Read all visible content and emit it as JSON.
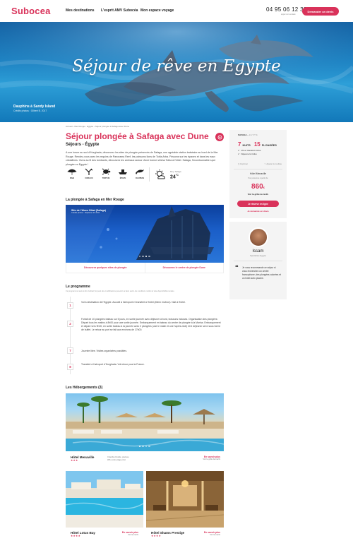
{
  "header": {
    "logo": "Subocea",
    "nav": [
      "Mes destinations",
      "L'esprit AMV Subocéa",
      "Mon espace voyage"
    ],
    "phone": "04 95 06 12 39",
    "phone_sub": "appel non surtaxé",
    "cta": "Demander un devis"
  },
  "hero": {
    "title": "Séjour de rêve en Egypte",
    "caption_title": "Dauphins à Sandy Island",
    "caption_credit": "Crédits photos : Gilbert B. 2017"
  },
  "breadcrumb": "Accueil › Mer Rouge › Egypte › Séjour plongée à Safaga avec Dune",
  "trip": {
    "title": "Séjour plongée à Safaga avec Dune",
    "subtitle": "Séjours - Égypte",
    "intro": "A une heure au sud d'Hurghada, découvrez les sites de plongée préservés de Safaga, une agréable station balnéaire au bord de la Mer Rouge. Rendez-vous avec les requins de Panorama Reef, les poissons lions de Tobia Arba. Frissons sur les épaves et dans les eaux cristallines. Vivez au fil des tombants, découvrez les animaux autour d'une bonne shisha Tobia à l'hôtel. Safaga, l'incontournable spot plongée en Egypte !",
    "fauna": [
      {
        "icon": "ray-icon",
        "label": "RAIE"
      },
      {
        "icon": "coral-icon",
        "label": "CORAUX"
      },
      {
        "icon": "turtle-icon",
        "label": "TORTUE"
      },
      {
        "icon": "wreck-icon",
        "label": "ÉPAVE"
      },
      {
        "icon": "dolphin-icon",
        "label": "DAUPHIN"
      }
    ],
    "weather_label": "Moy. Safaga",
    "weather_temp": "24",
    "weather_unit": "°C"
  },
  "dive": {
    "section_title": "La plongée à Safaga en Mer Rouge",
    "caption_title": "Site de l'Abou Gibal (Safaga)",
    "caption_credit": "Crédits photos : Stéphane M. 2016",
    "link_left": "Découvrez quelques sites de plongée",
    "link_right": "Découvrez le centre de plongée Dune"
  },
  "program": {
    "title": "Le programme",
    "note": "Ce programme reste à titre indicatif, le pack des modifications peuvent se faire selon les conditions météo et des disponibilités locales.",
    "days": [
      {
        "day": "1",
        "text": "Vol à destination de l'Egypte. Accueil à l'aéroport et transfert à l'hôtel (45mn environ). Nuit à l'hôtel."
      },
      {
        "day": "2",
        "text": "Forfait de 10 plongées bateau sur 5 jours, en sortie journée avec déjeuner à bord, boissons incluses. Organisation des plongées : Départ tous les matins à 8h00 pour une sortie journée. Embarquement en bateau du centre de plongée à la Marina. Embarquement et départ vers 9h00, en sortie bateau à la journée avec 2 plongées (une le matin et une l'après-midi) et le déjeuner servi sous forme de buffet. Le retour au port se fait aux environs de 17h00."
      },
      {
        "day": "7",
        "text": "Journée libre. Visites organisées possibles."
      },
      {
        "day": "8",
        "text": "Transfert à l'aéroport d'Hurghada. Vol retour pour la France."
      }
    ]
  },
  "hotels": {
    "title": "Les Hébergements (3)",
    "items": [
      {
        "name": "Hôtel Menaville",
        "stars": "★★★",
        "meta_1": "Chambre Double, piscines,",
        "meta_2": "Wifi, accès plage privé",
        "price": "En savoir plus",
        "price_sub": "Voir la grille des tarifs"
      },
      {
        "name": "Hôtel Lotus Bay",
        "stars": "★★★★",
        "price": "En savoir plus",
        "price_sub": "Voir les tarifs"
      },
      {
        "name": "Hôtel Shams Prestige",
        "stars": "★★★★",
        "price": "En savoir plus",
        "price_sub": "Voir les tarifs"
      }
    ]
  },
  "sidebar": {
    "head": "SAFAGA",
    "head_sub": "EGYPTE",
    "nights_num": "7",
    "nights_label": "NUITS",
    "dives_num": "15",
    "dives_label": "PLONGÉES",
    "incl_1": "Vol et transfert inclus",
    "incl_2": "Déjeuners inclus",
    "icon_left": "Imprimer",
    "icon_right": "Ajouter à ma liste",
    "hotel": "Hôtel Menaville",
    "hotel_sub": "Par personne à partir de",
    "price": "860",
    "currency": "€",
    "grid": "Voir la grille de tarifs",
    "book": "Je réserve en ligne",
    "quote": "Je demande un devis"
  },
  "agent": {
    "name": "Issam",
    "role": "Spécialiste Egypte",
    "quote": "Je vous recommande ce séjour si vous recherchez un centre francophone, des plongées colorées et un hôtel avec piscine."
  }
}
